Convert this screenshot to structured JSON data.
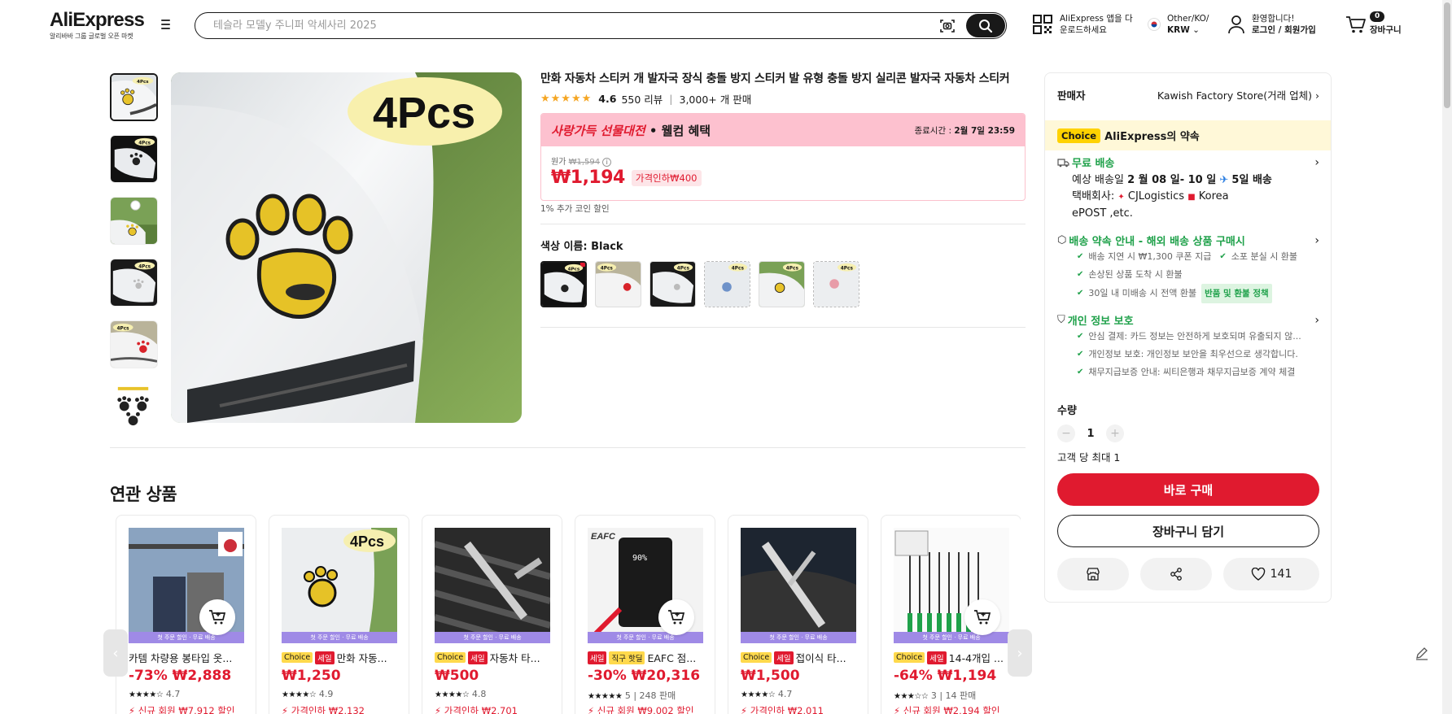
{
  "header": {
    "logo": "AliExpress",
    "logo_tagline": "알리바바 그룹 글로벌 오픈 마켓",
    "search_placeholder": "테슬라 모델y 주니퍼 악세사리 2025",
    "app_line1": "AliExpress 앱을 다",
    "app_line2": "운로드하세요",
    "region_line1": "Other/KO/",
    "region_line2": "KRW",
    "account_line1": "환영합니다!",
    "account_line2": "로그인 / 회원가입",
    "cart_count": "0",
    "cart_label": "장바구니"
  },
  "product": {
    "title": "만화 자동차 스티커 개 발자국 장식 충돌 방지 스티커 발 유형 충돌 방지 실리콘 발자국 자동차 스티커",
    "rating": "4.6",
    "reviews": "550 리뷰",
    "sold": "3,000+ 개 판매",
    "promo_title_red": "사랑가득 선물대전",
    "promo_title_rest": " • 웰컴 혜택",
    "promo_end_label": "종료시간 :",
    "promo_end_value": "2월 7일 23:59",
    "original_label": "원가",
    "original_price": "₩1,594",
    "price": "₩1,194",
    "discount": "가격인하₩400",
    "coin_note": "1% 추가 코인 할인",
    "color_label": "색상 이름: ",
    "color_value": "Black",
    "main_image_text": "4Pcs",
    "thumb_badge": "4Pcs"
  },
  "related": {
    "title": "연관 상품",
    "banner": "첫 주문 할인 · 무료 배송",
    "cards": [
      {
        "name": "카템 차량용 봉타입 옷...",
        "price": "-73% ₩2,888",
        "stars": "★★★★☆",
        "rating": "4.7",
        "extra": "",
        "coupon": "신규 회원 ₩7,912 할인",
        "tags": []
      },
      {
        "name": "만화 자동...",
        "price": "₩1,250",
        "stars": "★★★★☆",
        "rating": "4.9",
        "extra": "",
        "coupon": "가격인하 ₩2,132",
        "tags": [
          "Choice",
          "세일"
        ]
      },
      {
        "name": "자동차 타...",
        "price": "₩500",
        "stars": "★★★★☆",
        "rating": "4.8",
        "extra": "",
        "coupon": "가격인하 ₩2,701",
        "tags": [
          "Choice",
          "세일"
        ]
      },
      {
        "name": "EAFC 점...",
        "price": "-30% ₩20,316",
        "stars": "★★★★★",
        "rating": "5",
        "extra": "| 248 판매",
        "coupon": "신규 회원 ₩9,002 할인",
        "tags": [
          "세일",
          "직구 핫딜"
        ]
      },
      {
        "name": "접이식 타...",
        "price": "₩1,500",
        "stars": "★★★★☆",
        "rating": "4.7",
        "extra": "",
        "coupon": "가격인하 ₩2,011",
        "tags": [
          "Choice",
          "세일"
        ]
      },
      {
        "name": "14-4개입 ...",
        "price": "-64% ₩1,194",
        "stars": "★★★☆☆",
        "rating": "3",
        "extra": "| 14 판매",
        "coupon": "신규 회원 ₩2,194 할인",
        "tags": [
          "Choice",
          "세일"
        ]
      }
    ]
  },
  "panel": {
    "seller_label": "판매자",
    "seller_name": "Kawish Factory Store(거래 업체)",
    "choice_chip": "Choice",
    "choice_text": "AliExpress의 약속",
    "shipping_title": "무료 배송",
    "ship_est_prefix": "예상 배송일 ",
    "ship_est_date": "2 월 08 일- 10 일",
    "ship_days": "5일 배송",
    "carrier_prefix": "택배회사: ",
    "carrier_1": "CJLogistics",
    "carrier_2": "Korea",
    "carrier_3": "ePOST ,etc.",
    "promise_title": "배송 약속 안내 - 해외 배송 상품 구매시",
    "promise_1a": "배송 지연 시 ₩1,300 쿠폰 지급",
    "promise_1b": "소포 분실 시 환불",
    "promise_2": "손상된 상품 도착 시 환불",
    "promise_3": "30일 내 미배송 시 전액 환불",
    "promise_3_chip": "반품 및 환불 정책",
    "privacy_title": "개인 정보 보호",
    "privacy_1": "안심 결제: 카드 정보는 안전하게 보호되며 유출되지 않...",
    "privacy_2": "개인정보 보호: 개인정보 보안을 최우선으로 생각합니다.",
    "privacy_3": "채무지급보증 안내: 씨티은행과 채무지급보증 계약 체결",
    "qty_label": "수량",
    "qty_value": "1",
    "max_qty": "고객 당 최대 1",
    "buy_now": "바로 구매",
    "add_to_cart": "장바구니 담기",
    "wish_count": "141"
  },
  "colors": {
    "accent_red": "#e01a2f",
    "choice_yellow": "#ffd200",
    "green": "#1fa14a",
    "promo_pink": "#fdc1cf"
  }
}
